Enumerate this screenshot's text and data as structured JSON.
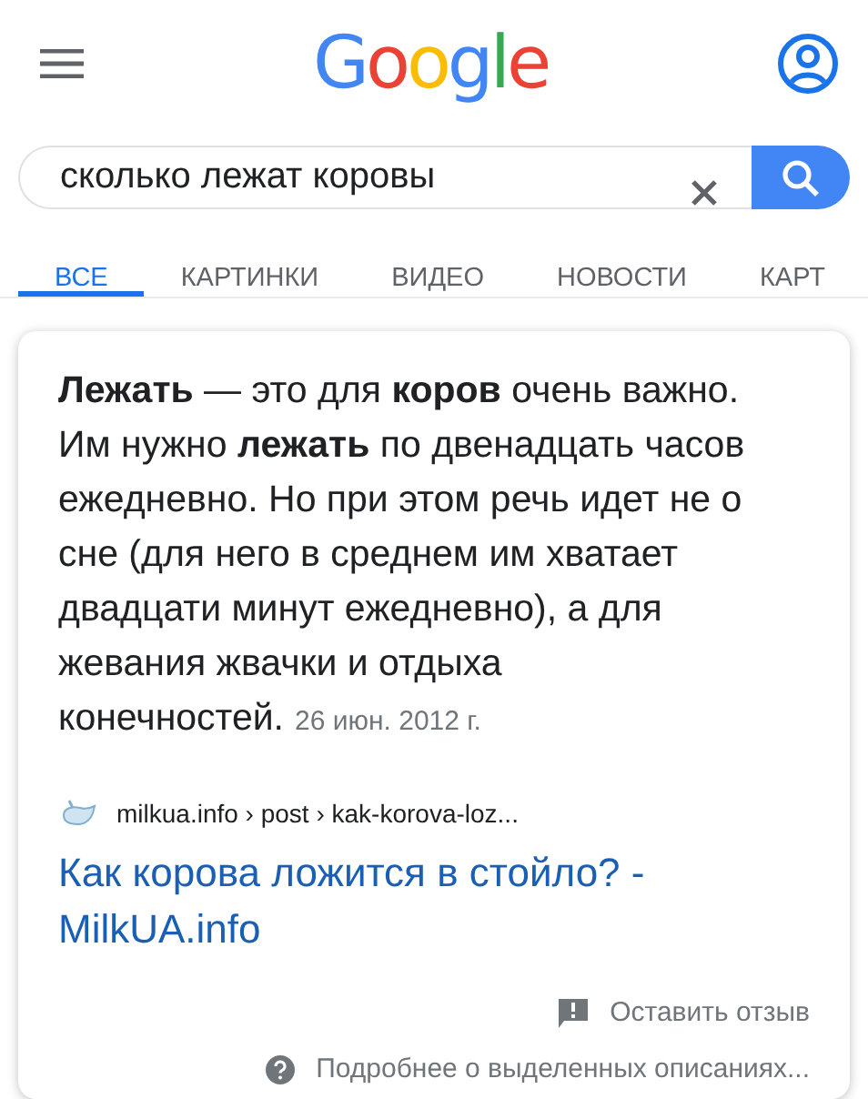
{
  "header": {
    "logo": "Google"
  },
  "search": {
    "value": "сколько лежат коровы"
  },
  "tabs": [
    {
      "label": "ВСЕ",
      "selected": true
    },
    {
      "label": "КАРТИНКИ",
      "selected": false
    },
    {
      "label": "ВИДЕО",
      "selected": false
    },
    {
      "label": "НОВОСТИ",
      "selected": false
    },
    {
      "label": "КАРТ",
      "selected": false
    }
  ],
  "snippet": {
    "text": "**Лежать** — это для **коров** очень важно. Им нужно **лежать** по двенадцать часов ежедневно. Но при этом речь идет не о сне (для него в среднем им хватает двадцати минут ежедневно), а для жевания жвачки и отдыха конечностей.",
    "date": "26 июн. 2012 г.",
    "breadcrumb": "milkua.info › post › kak-korova-loz...",
    "title": "Как корова ложится в стойло? - MilkUA.info",
    "feedback": "Оставить отзыв",
    "about": "Подробнее о выделенных описаниях..."
  }
}
